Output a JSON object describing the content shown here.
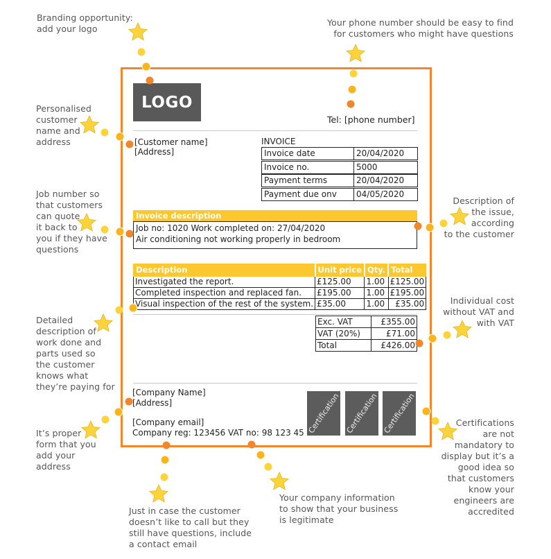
{
  "annotations": {
    "branding": "Branding opportunity:\nadd your logo",
    "phone": "Your phone number should be easy to find\n for customers who might have questions",
    "customer": "Personalised\ncustomer\nname and\naddress",
    "job_number": "Job number so\nthat customers\ncan quote\nit back to\nyou if they have\nquestions",
    "issue": "Description of\nthe issue,\naccording\nto the customer",
    "cost": "Individual cost\nwithout VAT and\nwith VAT",
    "work_detail": "Detailed\ndescription of\nwork done and\nparts used so\nthe customer\nknows what\nthey’re paying for",
    "address": "It’s proper\nform that you\nadd your\naddress",
    "certifications": "Certifications\nare not\nmandatory to\ndisplay but it’s a\ngood idea so\nthat customers\nknow your\nengineers are\naccredited",
    "email": "Just in case the customer\ndoesn’t like to call but they\nstill have questions, include\na contact email",
    "company": "Your company information\nto show that your business\nis legitimate"
  },
  "invoice": {
    "logo_text": "LOGO",
    "tel": "Tel: [phone number]",
    "customer_name": "[Customer name]",
    "customer_address": "[Address]",
    "title": "INVOICE",
    "details": [
      {
        "label": "Invoice date",
        "value": "20/04/2020"
      },
      {
        "label": "Invoice no.",
        "value": "5000"
      },
      {
        "label": "Payment terms",
        "value": "20/04/2020"
      },
      {
        "label": "Payment due onv",
        "value": "04/05/2020"
      }
    ],
    "description_header": "Invoice description",
    "description_lines": [
      "Job no: 1020 Work completed on: 27/04/2020",
      "Air conditioning not working properly in bedroom"
    ],
    "items_headers": [
      "Description",
      "Unit price",
      "Qty.",
      "Total"
    ],
    "items": [
      {
        "description": "Investigated the report.",
        "unit_price": "£125.00",
        "qty": "1.00",
        "total": "£125.00"
      },
      {
        "description": "Completed inspection and replaced fan.",
        "unit_price": "£195.00",
        "qty": "1.00",
        "total": "£195.00"
      },
      {
        "description": "Visual inspection of the rest of the system.",
        "unit_price": "£35.00",
        "qty": "1.00",
        "total": "£35.00"
      }
    ],
    "totals": [
      {
        "label": "Exc. VAT",
        "value": "£355.00"
      },
      {
        "label": "VAT (20%)",
        "value": "£71.00"
      },
      {
        "label": "Total",
        "value": "£426.00"
      }
    ],
    "company_name": "[Company Name]",
    "company_address": "[Address]",
    "company_email": "[Company email]",
    "company_reg": "Company reg: 123456  VAT no: 98 123 45",
    "certifications": [
      "Certification",
      "Certification",
      "Certification"
    ]
  },
  "colors": {
    "frame": "#f2862a",
    "header_yellow": "#fdc82f",
    "logo_gray": "#595959",
    "dot_light": "#fdd33a",
    "dot_mid": "#fbb51b",
    "dot_dark": "#f2862a"
  }
}
